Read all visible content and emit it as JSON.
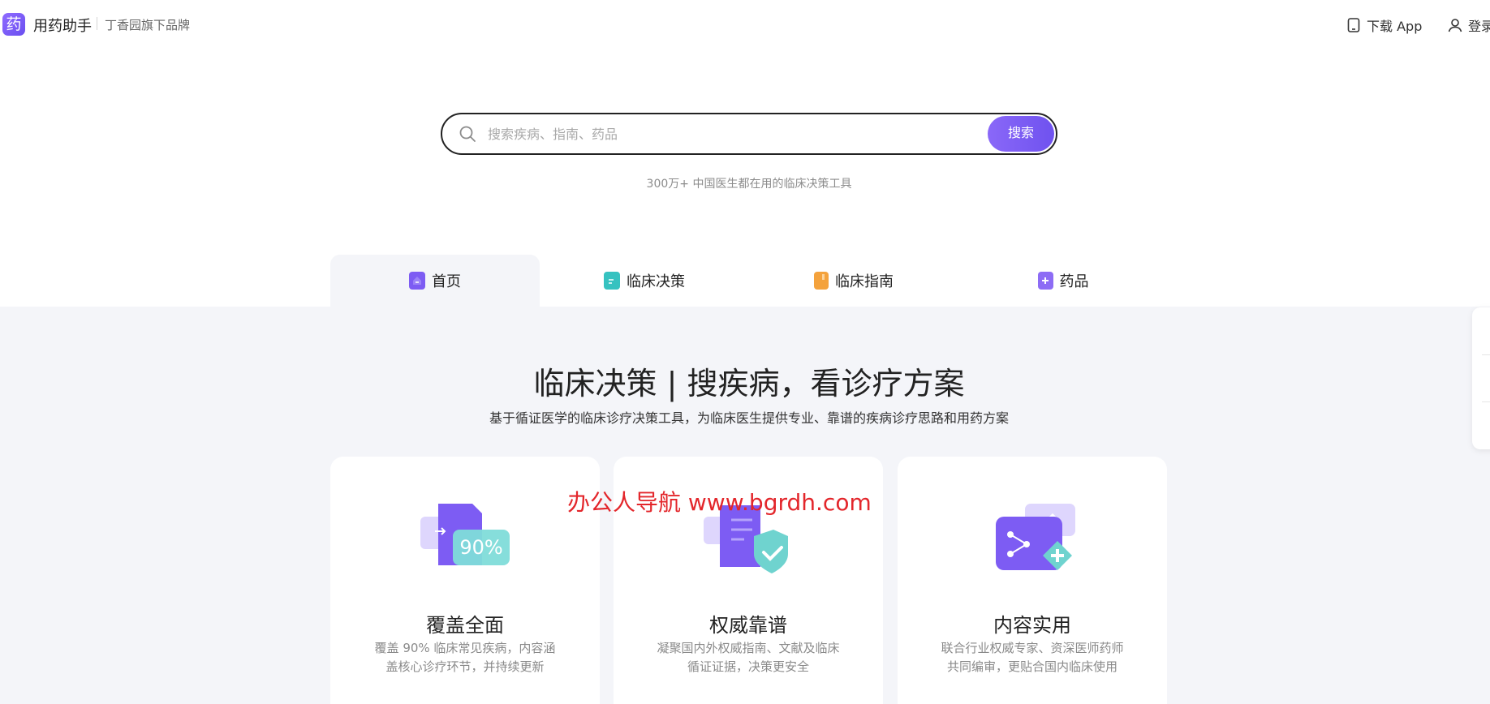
{
  "header": {
    "logo_char": "药",
    "app_name": "用药助手",
    "brand_sub": "丁香园旗下品牌",
    "download_label": "下载 App",
    "login_label": "登录"
  },
  "search": {
    "placeholder": "搜索疾病、指南、药品",
    "value": "",
    "button_label": "搜索",
    "tagline": "300万+ 中国医生都在用的临床决策工具"
  },
  "tabs": [
    {
      "label": "首页",
      "active": true,
      "icon": "home-icon",
      "color": "#7d5cf3"
    },
    {
      "label": "临床决策",
      "active": false,
      "icon": "clinical-decision-icon",
      "color": "#36c2c0"
    },
    {
      "label": "临床指南",
      "active": false,
      "icon": "guideline-book-icon",
      "color": "#f4a23c"
    },
    {
      "label": "药品",
      "active": false,
      "icon": "medicine-icon",
      "color": "#8d6cf5"
    }
  ],
  "main": {
    "title": "临床决策 | 搜疾病，看诊疗方案",
    "subtitle": "基于循证医学的临床诊疗决策工具，为临床医生提供专业、靠谱的疾病诊疗思路和用药方案",
    "cards": [
      {
        "title": "覆盖全面",
        "desc": "覆盖 90% 临床常见疾病，内容涵盖核心诊疗环节，并持续更新",
        "badge": "90%"
      },
      {
        "title": "权威靠谱",
        "desc": "凝聚国内外权威指南、文献及临床循证证据，决策更安全"
      },
      {
        "title": "内容实用",
        "desc": "联合行业权威专家、资深医师药师共同编审，更贴合国内临床使用"
      }
    ]
  },
  "watermark": "办公人导航 www.bgrdh.com",
  "colors": {
    "accent": "#7b5cf5",
    "band_bg": "#f4f5f9",
    "watermark": "#e3262b"
  }
}
